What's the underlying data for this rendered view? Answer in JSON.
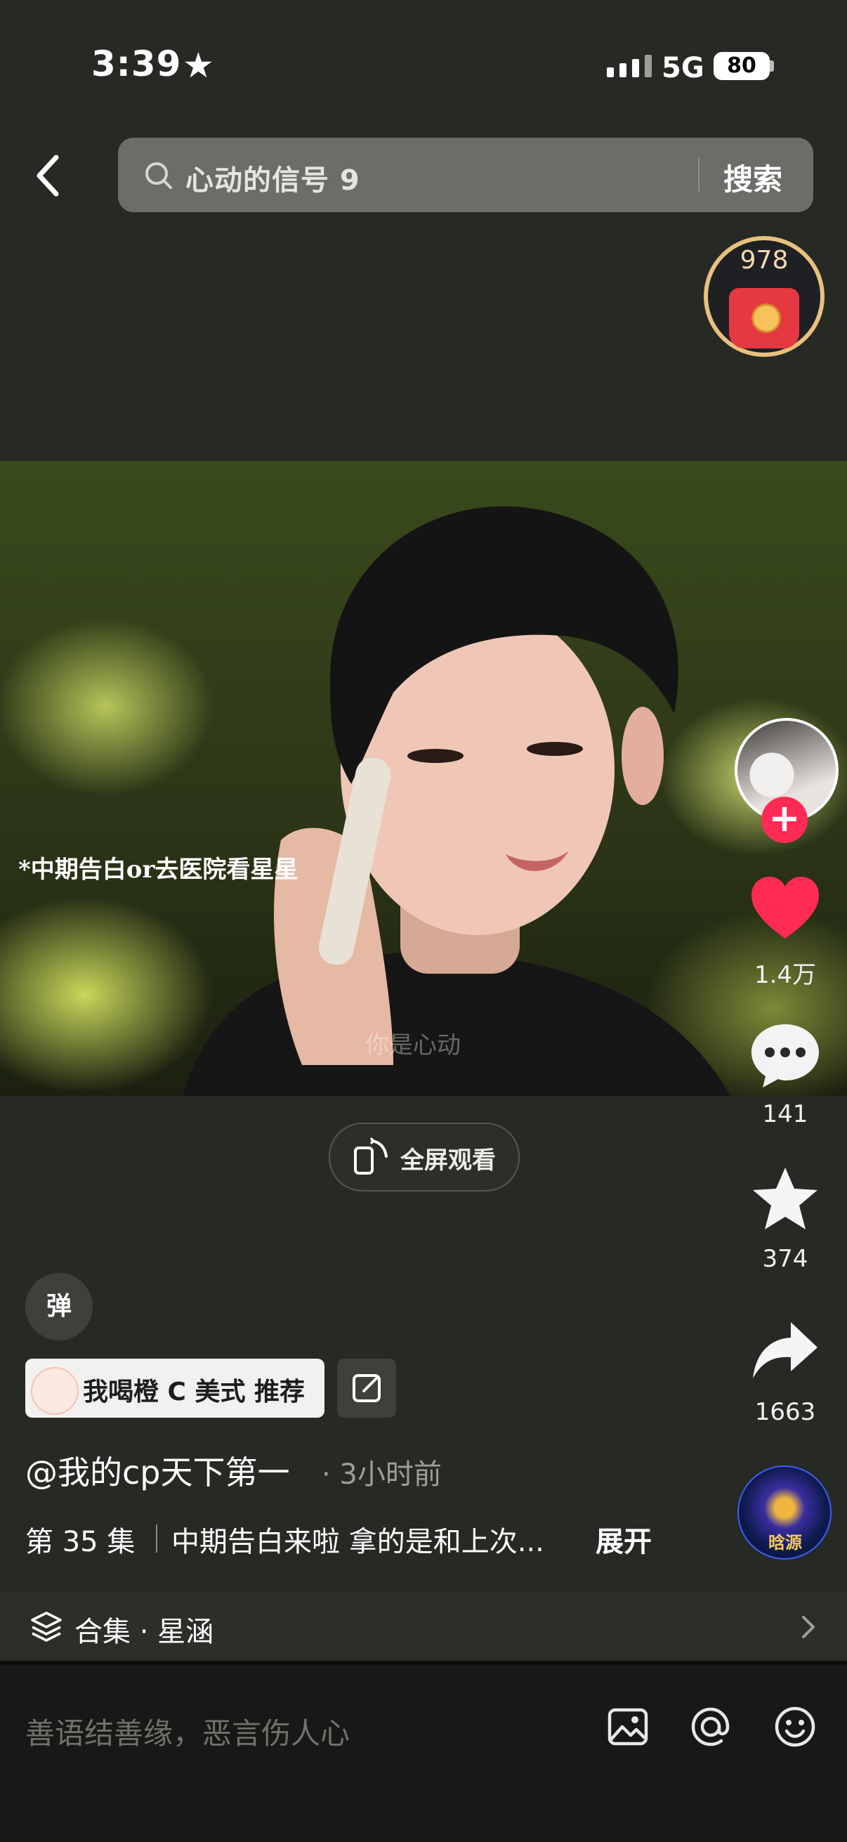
{
  "status": {
    "time": "3:39",
    "network": "5G",
    "battery": "80"
  },
  "search": {
    "query": "心动的信号 9",
    "button": "搜索"
  },
  "red_packet": {
    "count": "978"
  },
  "video": {
    "subtitle": "*中期告白or去医院看星星",
    "watermark": "你是心动"
  },
  "fullscreen": {
    "label": "全屏观看"
  },
  "actions": {
    "likes": "1.4万",
    "comments": "141",
    "favorites": "374",
    "shares": "1663"
  },
  "info": {
    "danmu": "弹",
    "sponsor_chip": "我喝橙 C 美式 推荐",
    "author": "@我的cp天下第一",
    "time_ago": "· 3小时前",
    "episode": "第 35 集",
    "description": "中期告白来啦 拿的是和上次...",
    "expand": "展开",
    "music_label": "晗源"
  },
  "collection": {
    "label": "合集 · 星涵"
  },
  "comment_input": {
    "placeholder": "善语结善缘，恶言伤人心"
  },
  "colors": {
    "background": "#272924",
    "like_red": "#fe2c55",
    "search_bg": "#6b6e68"
  }
}
